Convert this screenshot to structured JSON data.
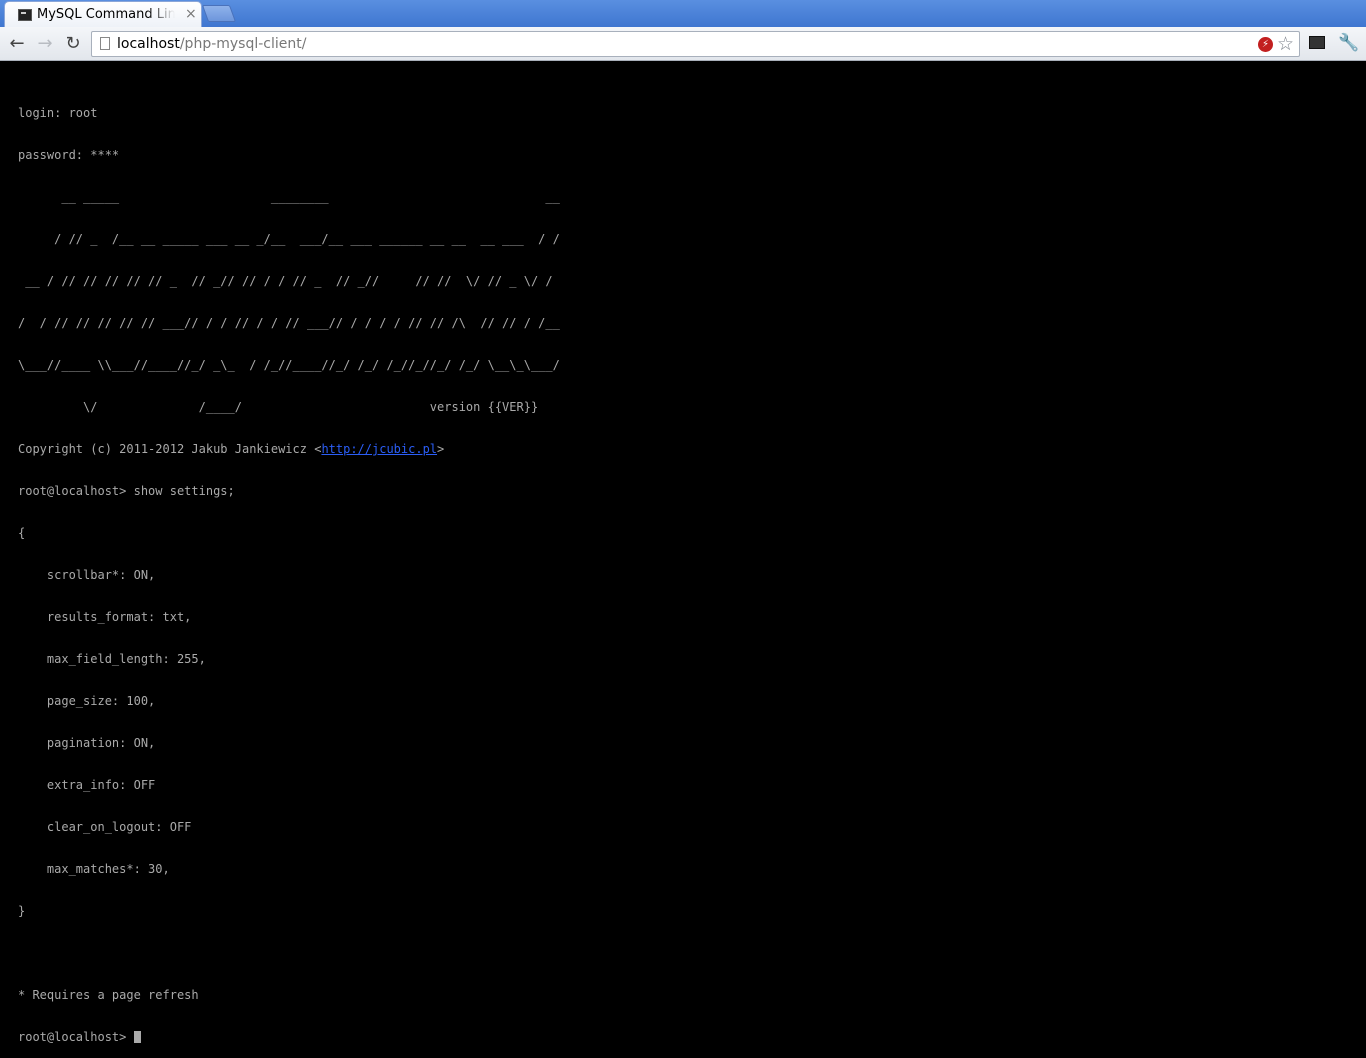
{
  "browser": {
    "tab_title": "MySQL Command Line Client",
    "tab_close": "×",
    "url_host": "localhost",
    "url_path": "/php-mysql-client/"
  },
  "icons": {
    "back": "arrow-left-icon",
    "forward": "arrow-right-icon",
    "reload": "reload-icon",
    "page": "page-icon",
    "blocked": "blocked-popup-icon",
    "bookmark": "star-icon",
    "extension": "terminal-extension-icon",
    "menu": "wrench-icon"
  },
  "colors": {
    "terminal_bg": "#000000",
    "terminal_fg": "#aaaaaa",
    "link": "#2b5ef7",
    "tabstrip": "#4a80d8"
  },
  "terminal": {
    "login": "login: root",
    "password": "password: ****",
    "banner": [
      "      __ _____                     ________                              __",
      "     / // _  /__ __ _____ ___ __ _/__  ___/__ ___ ______ __ __  __ ___  / /",
      " __ / // // // // // _  // _// // / / // _  // _//     // //  \\/ // _ \\/ /",
      "/  / // // // // // ___// / / // / / // ___// / / / / // // /\\  // // / /__",
      "\\___//____ \\\\___//____//_/ _\\_  / /_//____//_/ /_/ /_//_//_/ /_/ \\__\\_\\___/",
      "         \\/              /____/                          version {{VER}}"
    ],
    "copyright_prefix": "Copyright (c) 2011-2012 Jakub Jankiewicz <",
    "copyright_link": "http://jcubic.pl",
    "copyright_suffix": ">",
    "command_line": "root@localhost> show settings;",
    "settings_open": "{",
    "settings": [
      "    scrollbar*: ON,",
      "    results_format: txt,",
      "    max_field_length: 255,",
      "    page_size: 100,",
      "    pagination: ON,",
      "    extra_info: OFF",
      "    clear_on_logout: OFF",
      "    max_matches*: 30,"
    ],
    "settings_close": "}",
    "note": "* Requires a page refresh",
    "prompt": "root@localhost> "
  }
}
